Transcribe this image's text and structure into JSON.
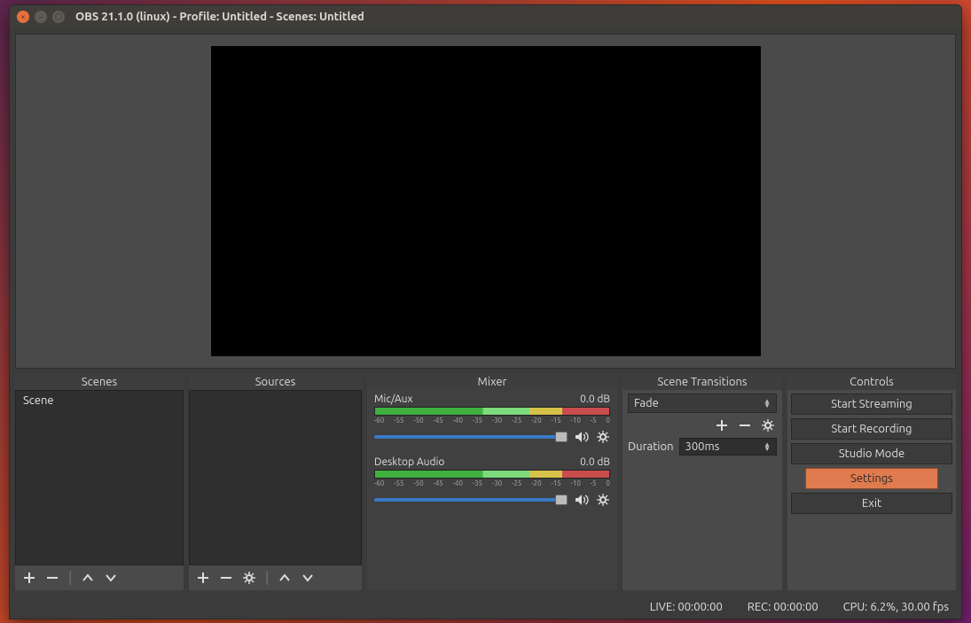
{
  "window": {
    "title": "OBS 21.1.0 (linux) - Profile: Untitled - Scenes: Untitled"
  },
  "panels": {
    "scenes": {
      "title": "Scenes",
      "items": [
        "Scene"
      ]
    },
    "sources": {
      "title": "Sources"
    },
    "mixer": {
      "title": "Mixer",
      "ticks": [
        "-60",
        "-55",
        "-50",
        "-45",
        "-40",
        "-35",
        "-30",
        "-25",
        "-20",
        "-15",
        "-10",
        "-5",
        "0"
      ],
      "tracks": [
        {
          "name": "Mic/Aux",
          "level": "0.0 dB"
        },
        {
          "name": "Desktop Audio",
          "level": "0.0 dB"
        }
      ]
    },
    "transitions": {
      "title": "Scene Transitions",
      "selected": "Fade",
      "duration_label": "Duration",
      "duration_value": "300ms"
    },
    "controls": {
      "title": "Controls",
      "buttons": {
        "stream": "Start Streaming",
        "record": "Start Recording",
        "studio": "Studio Mode",
        "settings": "Settings",
        "exit": "Exit"
      }
    }
  },
  "status": {
    "live": "LIVE: 00:00:00",
    "rec": "REC: 00:00:00",
    "cpu": "CPU: 6.2%, 30.00 fps"
  }
}
